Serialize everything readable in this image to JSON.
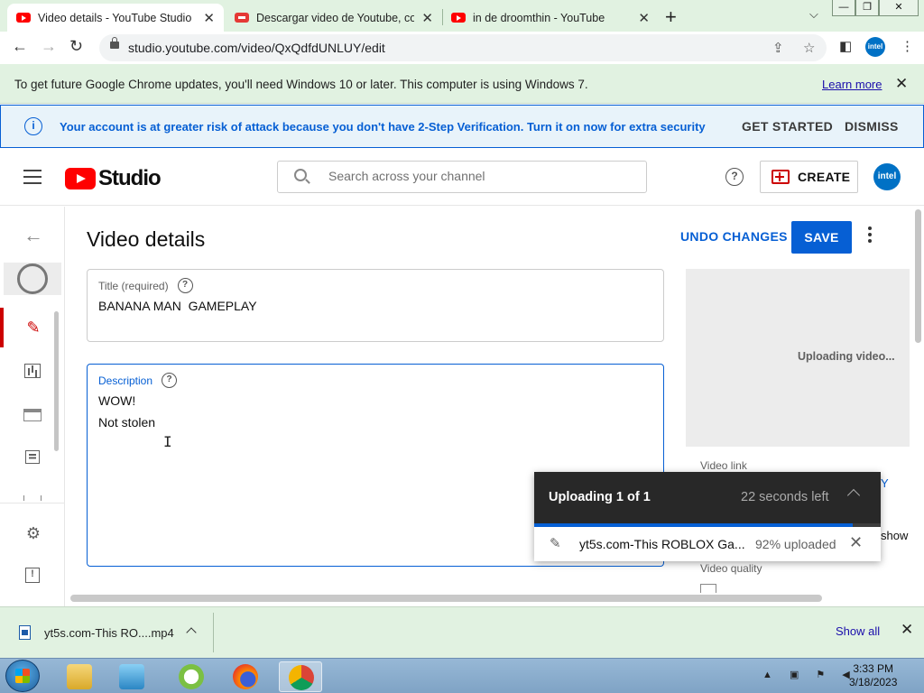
{
  "browser": {
    "tabs": [
      {
        "title": "Video details - YouTube Studio",
        "icon": "youtube-icon",
        "active": true
      },
      {
        "title": "Descargar video de Youtube, con",
        "icon": "download-site-icon",
        "active": false
      },
      {
        "title": "in de droomthin - YouTube",
        "icon": "youtube-icon",
        "active": false
      }
    ],
    "url": "studio.youtube.com/video/QxQdfdUNLUY/edit",
    "profile_label": "intel"
  },
  "update_bar": {
    "message": "To get future Google Chrome updates, you'll need Windows 10 or later. This computer is using Windows 7.",
    "learn_more": "Learn more"
  },
  "security_banner": {
    "message": "Your account is at greater risk of attack because you don't have 2-Step Verification. Turn it on now for extra security",
    "get_started": "GET STARTED",
    "dismiss": "DISMISS"
  },
  "header": {
    "logo_text": "Studio",
    "search_placeholder": "Search across your channel",
    "create_label": "CREATE",
    "avatar_label": "intel"
  },
  "page": {
    "title": "Video details",
    "undo_label": "UNDO CHANGES",
    "save_label": "SAVE",
    "title_field": {
      "label": "Title (required)",
      "value": "BANANA MAN  GAMEPLAY"
    },
    "description_field": {
      "label": "Description",
      "lines": [
        "WOW!",
        "Not stolen"
      ]
    },
    "preview": {
      "status": "Uploading video..."
    },
    "video_link_label": "Video link",
    "video_quality_label": "Video quality",
    "link_fragment": "Y",
    "filename_fragment": "show"
  },
  "upload": {
    "title": "Uploading 1 of 1",
    "time_left": "22 seconds left",
    "filename": "yt5s.com-This ROBLOX Ga...",
    "percent_text": "92% uploaded",
    "progress": 0.92
  },
  "downloads": {
    "filename": "yt5s.com-This RO....mp4",
    "show_all": "Show all"
  },
  "taskbar": {
    "time": "3:33 PM",
    "date": "3/18/2023"
  },
  "colors": {
    "accent_blue": "#065fd4",
    "youtube_red": "#ff0000",
    "chrome_frame": "#e1f2e1",
    "upload_header": "#282828"
  }
}
